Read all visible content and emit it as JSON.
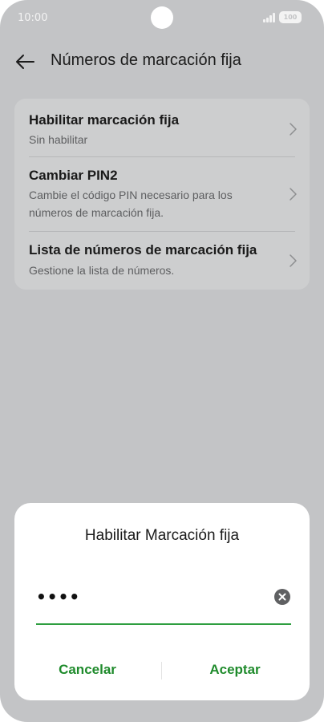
{
  "status_bar": {
    "time": "10:00",
    "battery": "100",
    "icons": [
      "signal-icon",
      "battery-icon"
    ]
  },
  "header": {
    "back_icon": "arrow-left-icon",
    "title": "Números de marcación fija"
  },
  "settings": {
    "items": [
      {
        "title": "Habilitar marcación fija",
        "subtitle": "Sin habilitar"
      },
      {
        "title": "Cambiar PIN2",
        "subtitle": "Cambie el código PIN necesario para los números de marcación fija."
      },
      {
        "title": "Lista de números de marcación fija",
        "subtitle": "Gestione la lista de números."
      }
    ],
    "chevron_icon": "chevron-right-icon"
  },
  "dialog": {
    "title": "Habilitar Marcación fija",
    "pin_value": "••••",
    "clear_icon": "clear-circle-icon",
    "cancel_label": "Cancelar",
    "accept_label": "Aceptar"
  },
  "colors": {
    "background": "#c3c4c6",
    "card": "#cdcecf",
    "accent": "#1f8b2c",
    "underline": "#2e9e3f"
  }
}
